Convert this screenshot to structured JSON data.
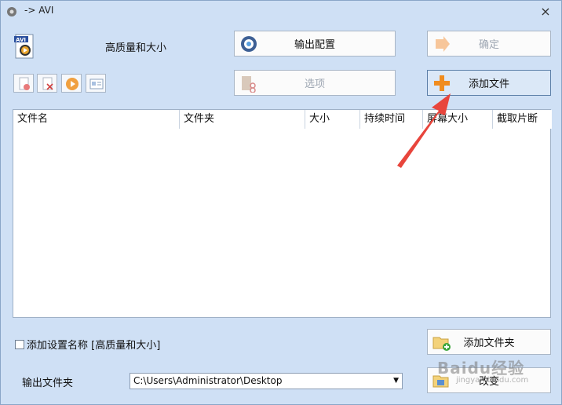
{
  "window": {
    "title": "-> AVI",
    "close_glyph": "×"
  },
  "preset": {
    "format_badge": "AVI",
    "label": "高质量和大小"
  },
  "buttons": {
    "output_config": "输出配置",
    "confirm": "确定",
    "options": "选项",
    "add_file": "添加文件",
    "add_folder": "添加文件夹",
    "change": "改变"
  },
  "toolbar": [
    {
      "name": "remove-icon"
    },
    {
      "name": "clear-icon"
    },
    {
      "name": "play-icon"
    },
    {
      "name": "info-icon"
    }
  ],
  "file_list": {
    "columns": [
      "文件名",
      "文件夹",
      "大小",
      "持续时间",
      "屏幕大小",
      "截取片断"
    ],
    "rows": []
  },
  "add_preset_name": {
    "label": "添加设置名称 [高质量和大小]",
    "checked": false
  },
  "output_folder": {
    "label": "输出文件夹",
    "value": "C:\\Users\\Administrator\\Desktop"
  },
  "watermark": {
    "text": "Baidu经验",
    "sub": "jingyan.baidu.com"
  },
  "colors": {
    "accent_arrow": "#e8453c",
    "window_bg": "#cfe0f5"
  }
}
